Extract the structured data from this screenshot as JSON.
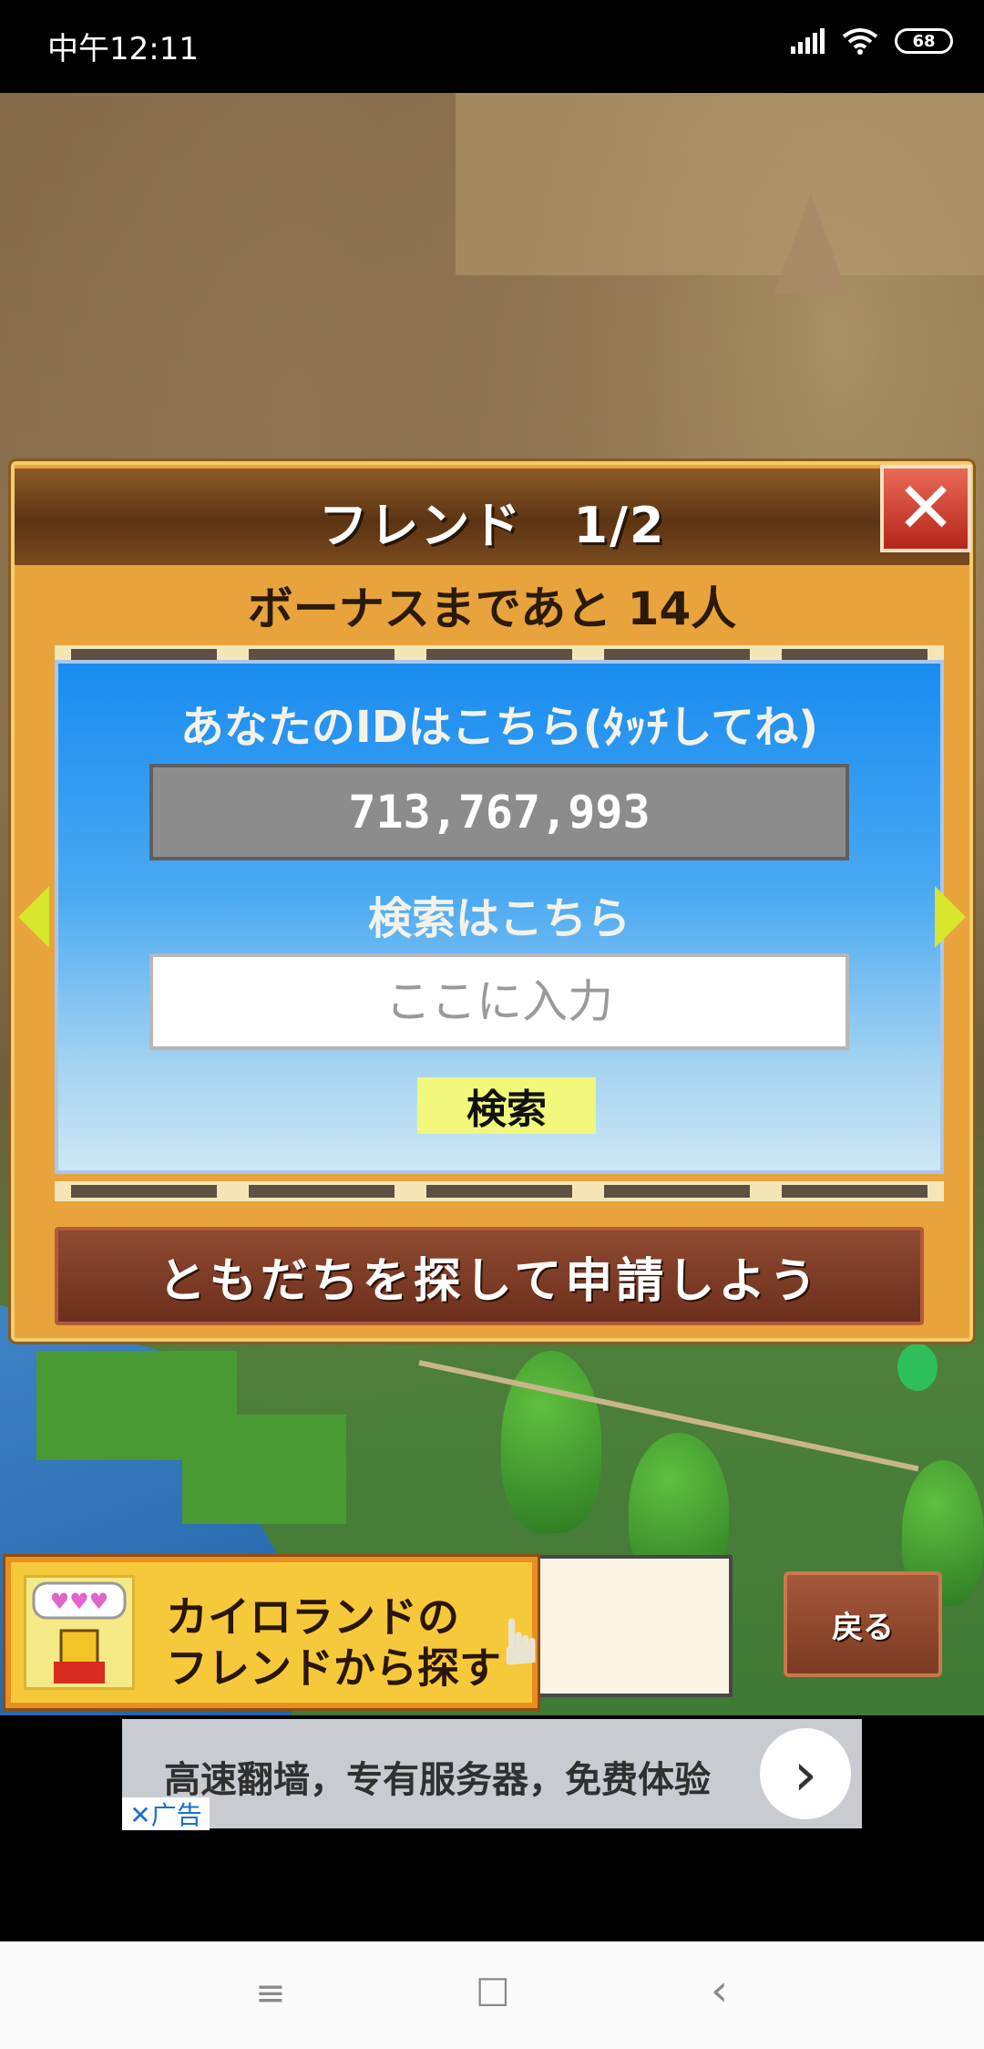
{
  "status_bar": {
    "time": "中午12:11",
    "battery": "68",
    "icons": [
      "signal-icon",
      "wifi-icon",
      "battery-icon"
    ]
  },
  "dialog": {
    "title": "フレンド　1/2",
    "close_symbol": "✕",
    "bonus_text": "ボーナスまであと 14人",
    "id_label": "あなたのIDはこちら(ﾀｯﾁしてね)",
    "id_value": "713,767,993",
    "search_label": "検索はこちら",
    "search_placeholder": "ここに入力",
    "search_button": "検索",
    "find_friends_button": "ともだちを探して申請しよう"
  },
  "game_bar": {
    "kairo_button_line1": "カイロランドの",
    "kairo_button_line2": "フレンドから探す",
    "back_button": "戻る"
  },
  "ad": {
    "text": "高速翻墙，专有服务器，免费体验",
    "tag": "✕广告"
  },
  "nav_bar": {
    "menu": "≡",
    "home": "□",
    "back": "‹"
  },
  "colors": {
    "dialog_frame": "#e8a33c",
    "panel_blue": "#1a8cf0",
    "search_button": "#f0f77a",
    "find_button": "#7b3a22"
  }
}
